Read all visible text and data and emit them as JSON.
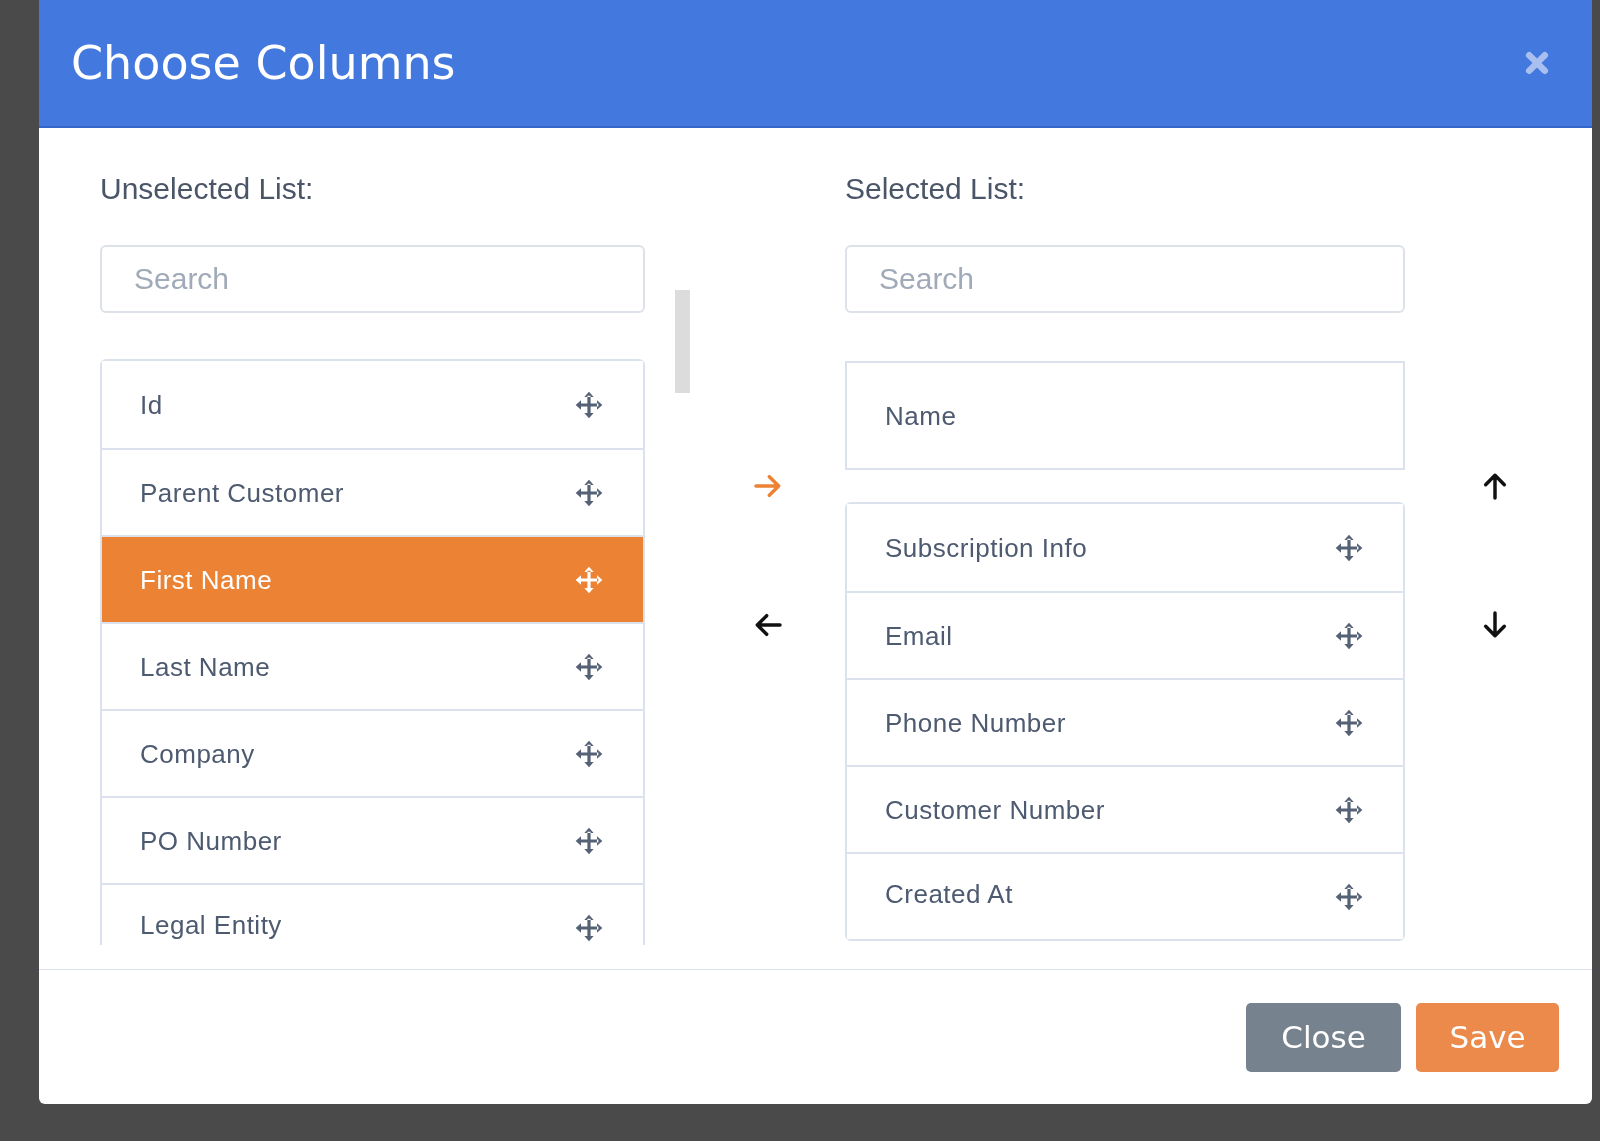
{
  "dialog": {
    "title": "Choose Columns"
  },
  "unselected": {
    "label": "Unselected List:",
    "search": {
      "placeholder": "Search"
    },
    "items": [
      {
        "label": "Id",
        "selected": false
      },
      {
        "label": "Parent Customer",
        "selected": false
      },
      {
        "label": "First Name",
        "selected": true
      },
      {
        "label": "Last Name",
        "selected": false
      },
      {
        "label": "Company",
        "selected": false
      },
      {
        "label": "PO Number",
        "selected": false
      },
      {
        "label": "Legal Entity",
        "selected": false
      }
    ]
  },
  "transfer_buttons": [
    {
      "kind": "right",
      "active": true
    },
    {
      "kind": "left",
      "active": false
    }
  ],
  "selected": {
    "label": "Selected List:",
    "search": {
      "placeholder": "Search"
    },
    "pinned_item": "Name",
    "items": [
      {
        "label": "Subscription Info",
        "selected": false
      },
      {
        "label": "Email",
        "selected": false
      },
      {
        "label": "Phone Number",
        "selected": false
      },
      {
        "label": "Customer Number",
        "selected": false
      },
      {
        "label": "Created At",
        "selected": false
      }
    ]
  },
  "order_buttons": [
    {
      "kind": "up"
    },
    {
      "kind": "down"
    }
  ],
  "footer": {
    "buttons": [
      {
        "label": "Close",
        "kind": "secondary"
      },
      {
        "label": "Save",
        "kind": "primary"
      }
    ]
  }
}
